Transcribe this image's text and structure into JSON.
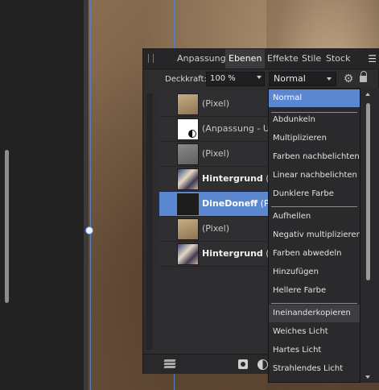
{
  "panel": {
    "tabs": [
      {
        "label": "Anpassung",
        "active": false
      },
      {
        "label": "Ebenen",
        "active": true
      },
      {
        "label": "Effekte",
        "active": false
      },
      {
        "label": "Stile",
        "active": false
      },
      {
        "label": "Stock",
        "active": false
      }
    ],
    "menu_icon": "menu-icon",
    "opacity_label": "Deckkraft:",
    "opacity_value": "100 %",
    "blend_mode": "Normal"
  },
  "layers": [
    {
      "name": "(Pixel)",
      "bold": false,
      "selected": false,
      "thumb": "tan"
    },
    {
      "name": "(Anpassung - U",
      "bold": false,
      "selected": false,
      "thumb": "white"
    },
    {
      "name": "(Pixel)",
      "bold": false,
      "selected": false,
      "thumb": "gray"
    },
    {
      "name": "Hintergrund",
      "suffix": " (P",
      "bold": true,
      "selected": false,
      "thumb": "photo"
    },
    {
      "name": "DineDoneff",
      "suffix": " (P",
      "bold": true,
      "selected": true,
      "thumb": "dark"
    },
    {
      "name": "(Pixel)",
      "bold": false,
      "selected": false,
      "thumb": "tan"
    },
    {
      "name": "Hintergrund",
      "suffix": " (P",
      "bold": true,
      "selected": false,
      "thumb": "photo"
    }
  ],
  "blend_modes": [
    {
      "label": "Normal",
      "state": "selected"
    },
    {
      "label": "Abdunkeln"
    },
    {
      "label": "Multiplizieren"
    },
    {
      "label": "Farben nachbelichten"
    },
    {
      "label": "Linear nachbelichten"
    },
    {
      "label": "Dunklere Farbe"
    },
    {
      "label": "Aufhellen"
    },
    {
      "label": "Negativ multiplizieren"
    },
    {
      "label": "Farben abwedeln"
    },
    {
      "label": "Hinzufügen"
    },
    {
      "label": "Hellere Farbe"
    },
    {
      "label": "Ineinanderkopieren",
      "state": "hover"
    },
    {
      "label": "Weiches Licht"
    },
    {
      "label": "Hartes Licht"
    },
    {
      "label": "Strahlendes Licht"
    }
  ],
  "colors": {
    "accent": "#5a87cf",
    "panel_bg": "#2d2d2f"
  }
}
